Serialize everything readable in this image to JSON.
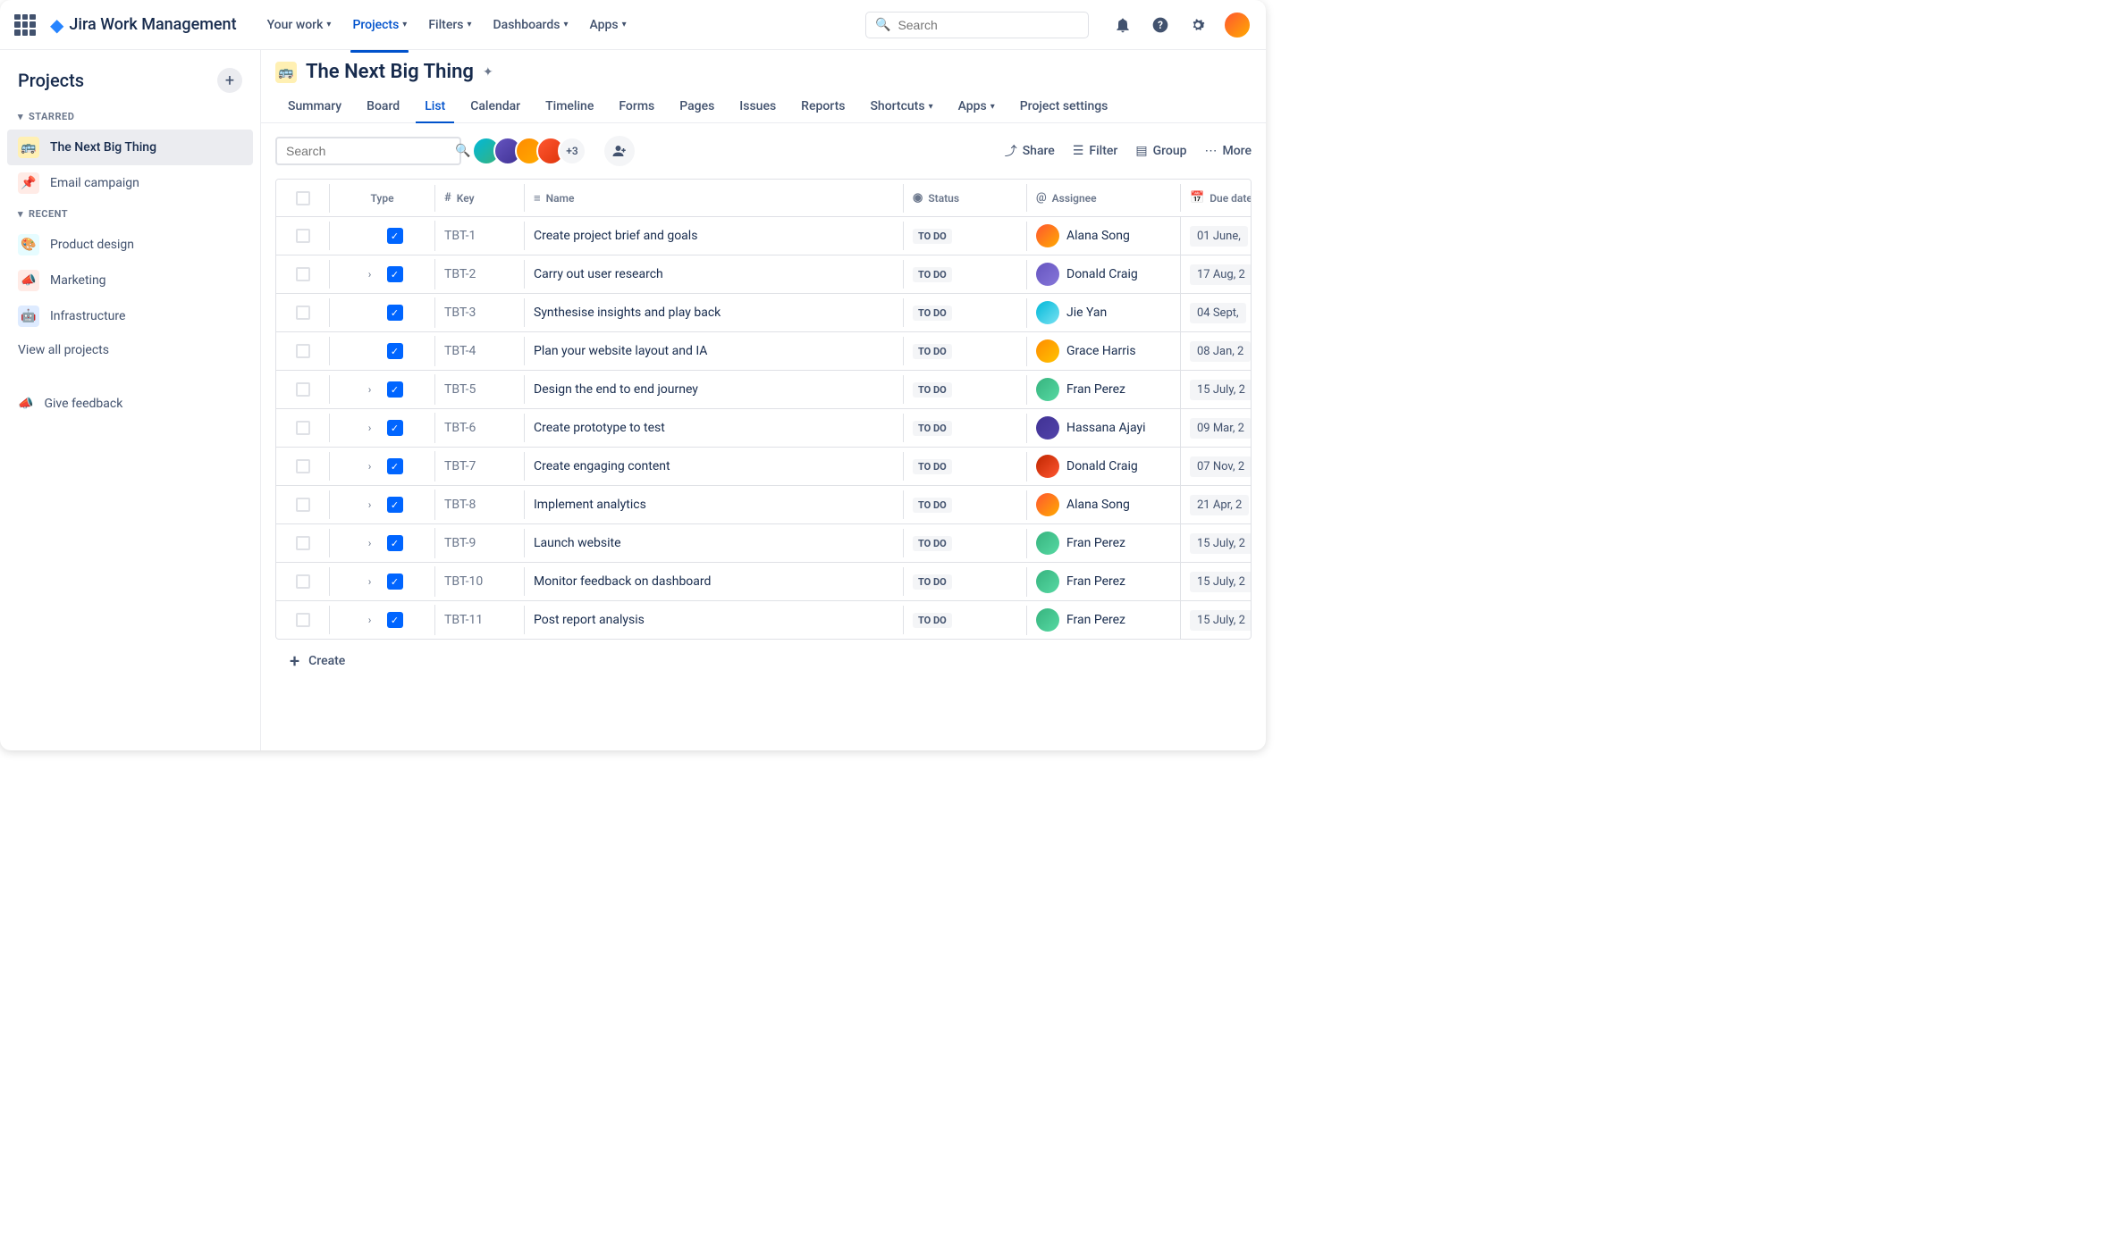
{
  "app_name": "Jira Work Management",
  "search_placeholder": "Search",
  "nav": [
    {
      "label": "Your work",
      "dropdown": true
    },
    {
      "label": "Projects",
      "dropdown": true,
      "active": true
    },
    {
      "label": "Filters",
      "dropdown": true
    },
    {
      "label": "Dashboards",
      "dropdown": true
    },
    {
      "label": "Apps",
      "dropdown": true
    }
  ],
  "sidebar": {
    "title": "Projects",
    "sections": [
      {
        "label": "STARRED",
        "items": [
          {
            "label": "The Next Big Thing",
            "icon": "🚌",
            "cls": "icon-bus",
            "active": true
          },
          {
            "label": "Email campaign",
            "icon": "📌",
            "cls": "icon-pin"
          }
        ]
      },
      {
        "label": "RECENT",
        "items": [
          {
            "label": "Product design",
            "icon": "🎨",
            "cls": "icon-des"
          },
          {
            "label": "Marketing",
            "icon": "📣",
            "cls": "icon-mkt"
          },
          {
            "label": "Infrastructure",
            "icon": "🤖",
            "cls": "icon-inf"
          }
        ]
      }
    ],
    "view_all": "View all projects",
    "feedback": "Give feedback"
  },
  "project": {
    "icon": "🚌",
    "title": "The Next Big Thing",
    "tabs": [
      "Summary",
      "Board",
      "List",
      "Calendar",
      "Timeline",
      "Forms",
      "Pages",
      "Issues",
      "Reports",
      "Shortcuts",
      "Apps",
      "Project settings"
    ],
    "active_tab": "List",
    "search_placeholder": "Search",
    "avatar_more": "+3",
    "actions": {
      "share": "Share",
      "filter": "Filter",
      "group": "Group",
      "more": "More"
    }
  },
  "columns": {
    "type": "Type",
    "key": "Key",
    "name": "Name",
    "status": "Status",
    "assignee": "Assignee",
    "due": "Due date"
  },
  "rows": [
    {
      "key": "TBT-1",
      "expand": false,
      "name": "Create project brief and goals",
      "status": "TO DO",
      "assignee": "Alana Song",
      "av": "av-a",
      "due": "01 June,"
    },
    {
      "key": "TBT-2",
      "expand": true,
      "name": "Carry out user research",
      "status": "TO DO",
      "assignee": "Donald Craig",
      "av": "av-b",
      "due": "17 Aug, 2"
    },
    {
      "key": "TBT-3",
      "expand": false,
      "name": "Synthesise insights and play back",
      "status": "TO DO",
      "assignee": "Jie Yan",
      "av": "av-c",
      "due": "04 Sept,"
    },
    {
      "key": "TBT-4",
      "expand": false,
      "name": "Plan your website layout and IA",
      "status": "TO DO",
      "assignee": "Grace Harris",
      "av": "av-d",
      "due": "08 Jan, 2"
    },
    {
      "key": "TBT-5",
      "expand": true,
      "name": "Design the end to end journey",
      "status": "TO DO",
      "assignee": "Fran Perez",
      "av": "av-e",
      "due": "15 July, 2"
    },
    {
      "key": "TBT-6",
      "expand": true,
      "name": "Create prototype to test",
      "status": "TO DO",
      "assignee": "Hassana Ajayi",
      "av": "av-f",
      "due": "09 Mar, 2"
    },
    {
      "key": "TBT-7",
      "expand": true,
      "name": "Create engaging content",
      "status": "TO DO",
      "assignee": "Donald Craig",
      "av": "av-g",
      "due": "07 Nov, 2"
    },
    {
      "key": "TBT-8",
      "expand": true,
      "name": "Implement analytics",
      "status": "TO DO",
      "assignee": "Alana Song",
      "av": "av-a",
      "due": "21 Apr, 2"
    },
    {
      "key": "TBT-9",
      "expand": true,
      "name": "Launch website",
      "status": "TO DO",
      "assignee": "Fran Perez",
      "av": "av-e",
      "due": "15 July, 2"
    },
    {
      "key": "TBT-10",
      "expand": true,
      "name": "Monitor feedback on dashboard",
      "status": "TO DO",
      "assignee": "Fran Perez",
      "av": "av-e",
      "due": "15 July, 2"
    },
    {
      "key": "TBT-11",
      "expand": true,
      "name": "Post report analysis",
      "status": "TO DO",
      "assignee": "Fran Perez",
      "av": "av-e",
      "due": "15 July, 2"
    }
  ],
  "create_label": "Create"
}
